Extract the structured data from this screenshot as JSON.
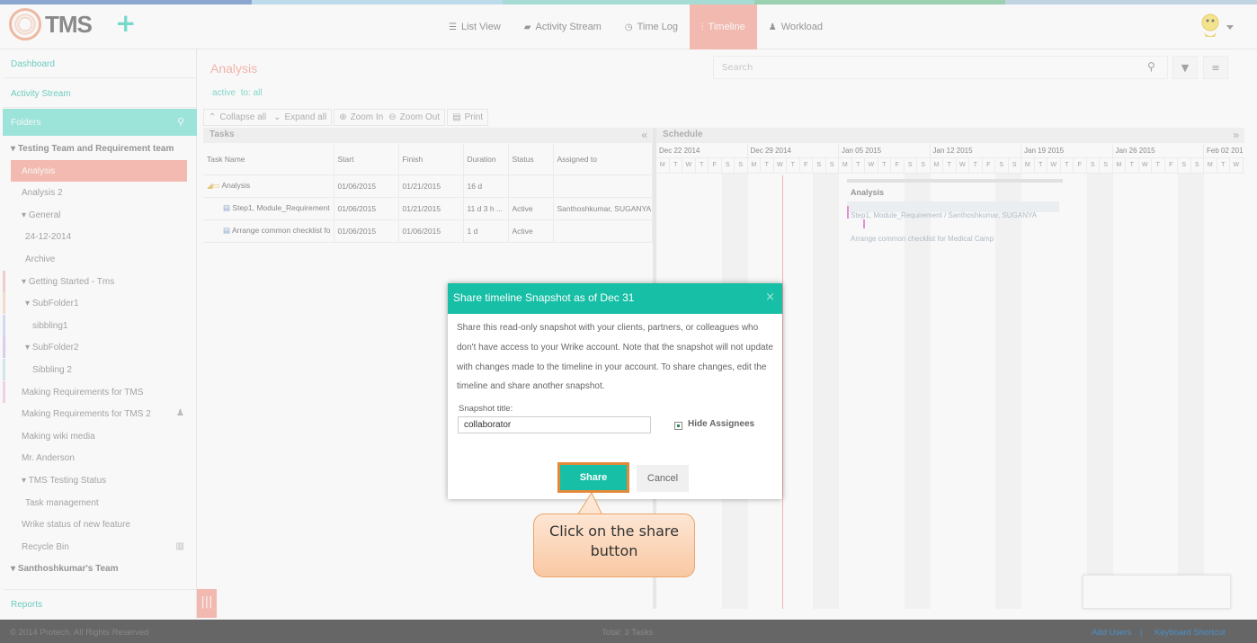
{
  "app": {
    "name": "TMS"
  },
  "colors": {
    "accent_teal": "#16bfa5",
    "active_tab": "#f6a89a",
    "title": "#f4a295",
    "stripe": [
      "#6a8fc6",
      "#aed7ee",
      "#8fd8cf",
      "#7ec89b",
      "#b2cfe0"
    ]
  },
  "nav": {
    "tabs": [
      {
        "label": "List View",
        "icon": "list-icon"
      },
      {
        "label": "Activity Stream",
        "icon": "chat-icon"
      },
      {
        "label": "Time Log",
        "icon": "clock-icon"
      },
      {
        "label": "Timeline",
        "icon": "timeline-icon",
        "active": true
      },
      {
        "label": "Workload",
        "icon": "person-icon"
      }
    ]
  },
  "sidebar": {
    "dashboard": "Dashboard",
    "activity_stream": "Activity Stream",
    "folders": "Folders",
    "items": [
      {
        "label": "Testing Team and Requirement team",
        "depth": 0,
        "bold": true,
        "caret": true
      },
      {
        "label": "Analysis",
        "depth": 1,
        "selected": true
      },
      {
        "label": "Analysis 2",
        "depth": 1
      },
      {
        "label": "General",
        "depth": 1,
        "caret": true
      },
      {
        "label": "24-12-2014",
        "depth": 2
      },
      {
        "label": "Archive",
        "depth": 2
      },
      {
        "label": "Getting Started - Tms",
        "depth": 1,
        "caret": true,
        "mark": "#f3c4c4"
      },
      {
        "label": "SubFolder1",
        "depth": 2,
        "caret": true,
        "mark": "#f3dcc0"
      },
      {
        "label": "sibbling1",
        "depth": 3,
        "mark": "#c8d8f0"
      },
      {
        "label": "SubFolder2",
        "depth": 2,
        "caret": true,
        "mark": "#d4c4ec"
      },
      {
        "label": "Sibbling 2",
        "depth": 3,
        "mark": "#c4e6ec"
      },
      {
        "label": "Making Requirements for TMS",
        "depth": 1,
        "mark": "#f0cce0"
      },
      {
        "label": "Making Requirements for TMS 2",
        "depth": 1,
        "icon": "user-icon"
      },
      {
        "label": "Making wiki media",
        "depth": 1
      },
      {
        "label": "Mr. Anderson",
        "depth": 1
      },
      {
        "label": "TMS Testing Status",
        "depth": 1,
        "caret": true
      },
      {
        "label": "Task management",
        "depth": 2
      },
      {
        "label": "Wrike status of new feature",
        "depth": 1
      },
      {
        "label": "Recycle Bin",
        "depth": 1,
        "icon": "trash-icon"
      },
      {
        "label": "Santhoshkumar's Team",
        "depth": 0,
        "bold": true,
        "caret": true
      }
    ],
    "reports": "Reports"
  },
  "main": {
    "title": "Analysis",
    "filter_active": "active",
    "filter_to": "to: all",
    "search_placeholder": "Search"
  },
  "toolbar": {
    "collapse_all": "Collapse all",
    "expand_all": "Expand all",
    "zoom_in": "Zoom In",
    "zoom_out": "Zoom Out",
    "print": "Print"
  },
  "tasks_panel": {
    "title": "Tasks",
    "columns": [
      "Task Name",
      "Start",
      "Finish",
      "Duration",
      "Status",
      "Assigned to"
    ],
    "rows": [
      {
        "name": "Analysis",
        "start": "01/06/2015",
        "finish": "01/21/2015",
        "duration": "16 d",
        "status": "",
        "assigned": "",
        "folder": true
      },
      {
        "name": "Step1, Module_Requirement",
        "start": "01/06/2015",
        "finish": "01/21/2015",
        "duration": "11 d 3 h ...",
        "status": "Active",
        "assigned": "Santhoshkumar, SUGANYA"
      },
      {
        "name": "Arrange common checklist fo",
        "start": "01/06/2015",
        "finish": "01/06/2015",
        "duration": "1 d",
        "status": "Active",
        "assigned": ""
      }
    ]
  },
  "schedule": {
    "title": "Schedule",
    "weeks": [
      "Dec 22 2014",
      "Dec 29 2014",
      "Jan 05 2015",
      "Jan 12 2015",
      "Jan 19 2015",
      "Jan 26 2015",
      "Feb 02 201"
    ],
    "days": [
      "M",
      "T",
      "W",
      "T",
      "F",
      "S",
      "S"
    ],
    "bar_title": "Analysis",
    "task1_label": "Step1, Module_Requirement / Santhoshkumar, SUGANYA",
    "task2_label": "Arrange common checklist for Medical Camp"
  },
  "dialog": {
    "title": "Share timeline Snapshot as of Dec 31",
    "close": "×",
    "body": "Share this read-only snapshot with your clients, partners, or colleagues who don't have access to your Wrike account.  Note that the snapshot will not update with changes made to the timeline in your account. To share changes, edit the timeline and share another snapshot.",
    "snapshot_label": "Snapshot title:",
    "snapshot_value": "collaborator",
    "hide_assignees": "Hide Assignees",
    "share": "Share",
    "cancel": "Cancel"
  },
  "callout": {
    "text": "Click on the share button"
  },
  "footer": {
    "copyright": "© 2014 Protech. All Rights Reserved",
    "total": "Total: 3 Tasks",
    "add_users": "Add Users",
    "sep": "|",
    "keyboard": "Keyboard Shortcut"
  }
}
